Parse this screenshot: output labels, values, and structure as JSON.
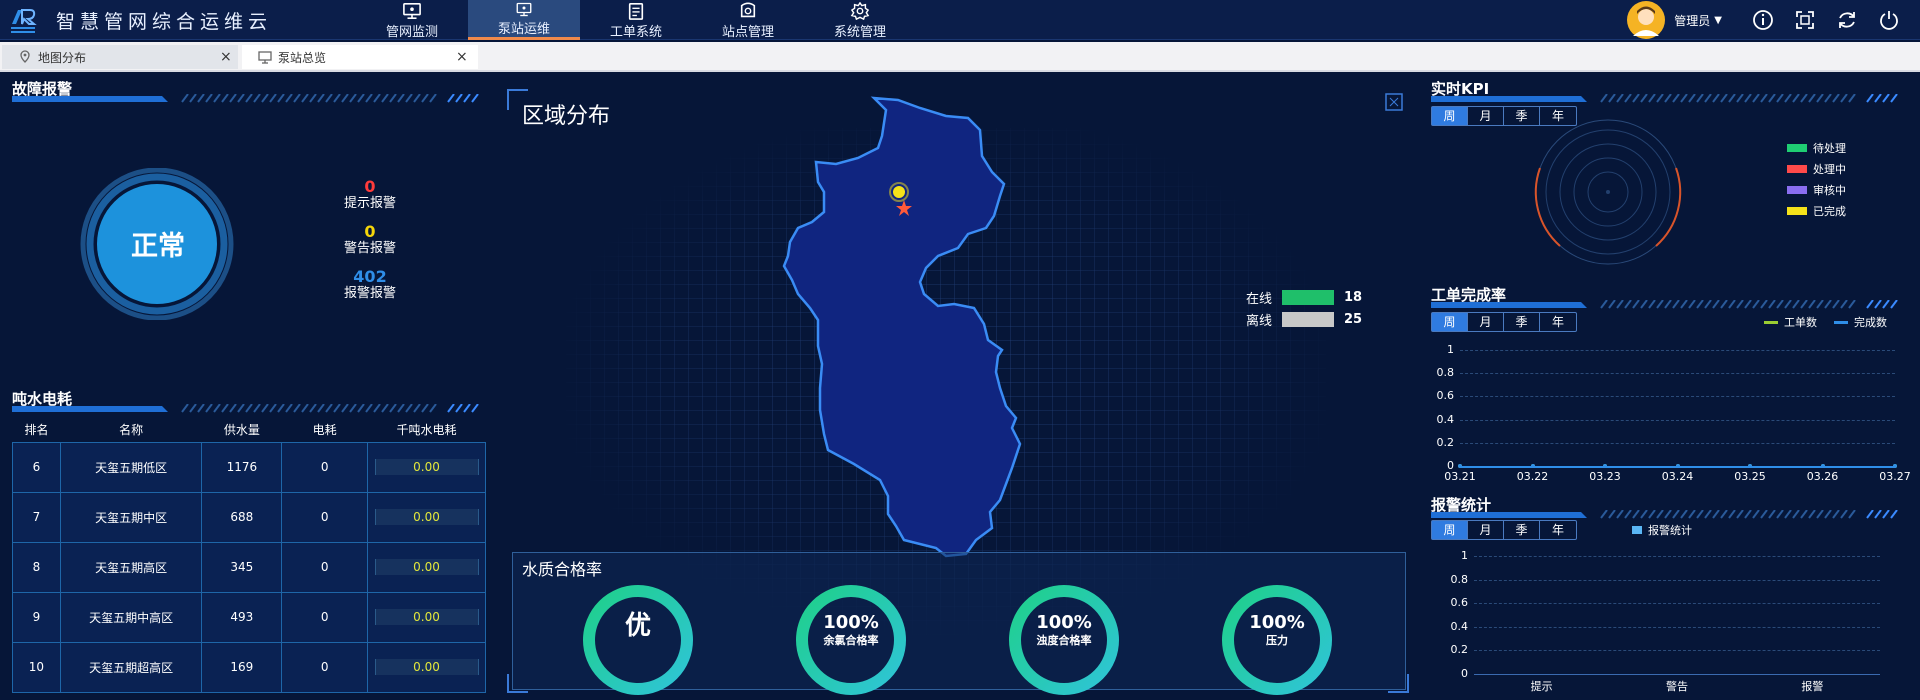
{
  "app": {
    "title": "智慧管网综合运维云"
  },
  "nav": [
    {
      "label": "管网监测",
      "icon": "monitor-icon"
    },
    {
      "label": "泵站运维",
      "icon": "monitor-icon"
    },
    {
      "label": "工单系统",
      "icon": "clipboard-icon"
    },
    {
      "label": "站点管理",
      "icon": "station-icon"
    },
    {
      "label": "系统管理",
      "icon": "gear-icon"
    }
  ],
  "nav_active": 1,
  "user": {
    "name": "管理员"
  },
  "tabs": [
    {
      "label": "地图分布",
      "icon": "map-pin-icon"
    },
    {
      "label": "泵站总览",
      "icon": "monitor-icon"
    }
  ],
  "fault": {
    "title": "故障报警",
    "status": "正常",
    "stats": [
      {
        "value": "0",
        "label": "提示报警",
        "color": "#ff3b3b"
      },
      {
        "value": "0",
        "label": "警告报警",
        "color": "#f5d60a"
      },
      {
        "value": "402",
        "label": "报警报警",
        "color": "#2f8ee8"
      }
    ]
  },
  "energy": {
    "title": "吨水电耗",
    "headers": [
      "排名",
      "名称",
      "供水量",
      "电耗",
      "千吨水电耗"
    ],
    "rows": [
      [
        "6",
        "天玺五期低区",
        "1176",
        "0",
        "0.00"
      ],
      [
        "7",
        "天玺五期中区",
        "688",
        "0",
        "0.00"
      ],
      [
        "8",
        "天玺五期高区",
        "345",
        "0",
        "0.00"
      ],
      [
        "9",
        "天玺五期中高区",
        "493",
        "0",
        "0.00"
      ],
      [
        "10",
        "天玺五期超高区",
        "169",
        "0",
        "0.00"
      ]
    ]
  },
  "region": {
    "title": "区域分布",
    "legend": [
      {
        "label": "在线",
        "value": "18",
        "color": "#1fbf6a"
      },
      {
        "label": "离线",
        "value": "25",
        "color": "#c8c8c8"
      }
    ]
  },
  "water_quality": {
    "title": "水质合格率",
    "items": [
      {
        "value": "优",
        "label": ""
      },
      {
        "value": "100%",
        "label": "余氯合格率"
      },
      {
        "value": "100%",
        "label": "浊度合格率"
      },
      {
        "value": "100%",
        "label": "压力"
      }
    ]
  },
  "period_buttons": [
    "周",
    "月",
    "季",
    "年"
  ],
  "kpi": {
    "title": "实时KPI",
    "legend": [
      {
        "label": "待处理",
        "color": "#1fce73"
      },
      {
        "label": "处理中",
        "color": "#ff4a4a"
      },
      {
        "label": "审核中",
        "color": "#8a6ef0"
      },
      {
        "label": "已完成",
        "color": "#f5e21a"
      }
    ]
  },
  "completion": {
    "title": "工单完成率",
    "legend": [
      {
        "label": "工单数",
        "color": "#9acd32"
      },
      {
        "label": "完成数",
        "color": "#2f8ee8"
      }
    ]
  },
  "alarm_stats": {
    "title": "报警统计",
    "legend": [
      {
        "label": "报警统计",
        "color": "#5ab6f5"
      }
    ]
  },
  "chart_data": [
    {
      "type": "line",
      "x": [
        "03.21",
        "03.22",
        "03.23",
        "03.24",
        "03.25",
        "03.26",
        "03.27"
      ],
      "series": [
        {
          "name": "工单数",
          "values": [
            0,
            0,
            0,
            0,
            0,
            0,
            0
          ]
        },
        {
          "name": "完成数",
          "values": [
            0,
            0,
            0,
            0,
            0,
            0,
            0
          ]
        }
      ],
      "yticks": [
        "0",
        "0.2",
        "0.4",
        "0.6",
        "0.8",
        "1"
      ],
      "ylim": [
        0,
        1
      ]
    },
    {
      "type": "bar",
      "categories": [
        "提示",
        "警告",
        "报警"
      ],
      "series": [
        {
          "name": "报警统计",
          "values": [
            0,
            0,
            0
          ]
        }
      ],
      "yticks": [
        "0",
        "0.2",
        "0.4",
        "0.6",
        "0.8",
        "1"
      ],
      "ylim": [
        0,
        1
      ]
    }
  ]
}
